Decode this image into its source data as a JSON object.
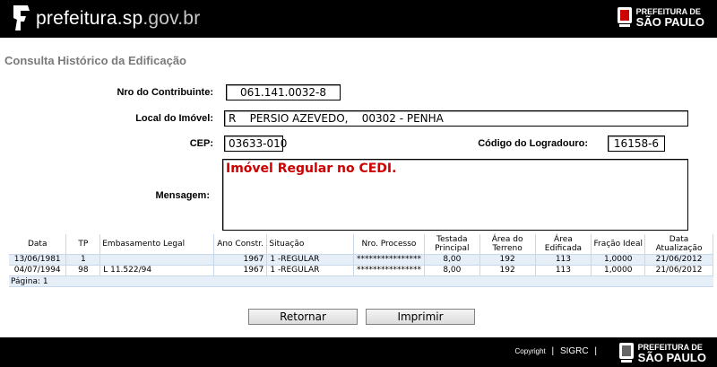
{
  "header": {
    "site_name_main": "prefeitura.sp",
    "site_name_tld": ".gov.br",
    "logo_line1": "PREFEITURA DE",
    "logo_line2": "SÃO PAULO"
  },
  "page_title": "Consulta Histórico da Edificação",
  "form": {
    "contribuinte_label": "Nro do Contribuinte:",
    "contribuinte_value": "061.141.0032-8",
    "local_label": "Local do Imóvel:",
    "local_value": "R    PERSIO AZEVEDO,    00302 - PENHA",
    "cep_label": "CEP:",
    "cep_value": "03633-010",
    "logradouro_label": "Código do Logradouro:",
    "logradouro_value": "16158-6",
    "mensagem_label": "Mensagem:",
    "mensagem_value": "Imóvel Regular no CEDI."
  },
  "table": {
    "headers": [
      "Data",
      "TP",
      "Embasamento Legal",
      "Ano Constr.",
      "Situação",
      "Nro. Processo",
      "Testada Principal",
      "Área do Terreno",
      "Área Edificada",
      "Fração Ideal",
      "Data Atualização"
    ],
    "rows": [
      [
        "13/06/1981",
        "1",
        "",
        "1967",
        "1 -REGULAR",
        "****************",
        "8,00",
        "192",
        "113",
        "1,0000",
        "21/06/2012"
      ],
      [
        "04/07/1994",
        "98",
        "L 11.522/94",
        "1967",
        "1 -REGULAR",
        "****************",
        "8,00",
        "192",
        "113",
        "1,0000",
        "21/06/2012"
      ]
    ],
    "pagination": "Página: 1"
  },
  "buttons": {
    "retornar": "Retornar",
    "imprimir": "Imprimir"
  },
  "footer": {
    "copyright": "Copyright",
    "separator": "|",
    "sigrc": "SIGRC",
    "logo_line1": "PREFEITURA DE",
    "logo_line2": "SÃO PAULO"
  }
}
